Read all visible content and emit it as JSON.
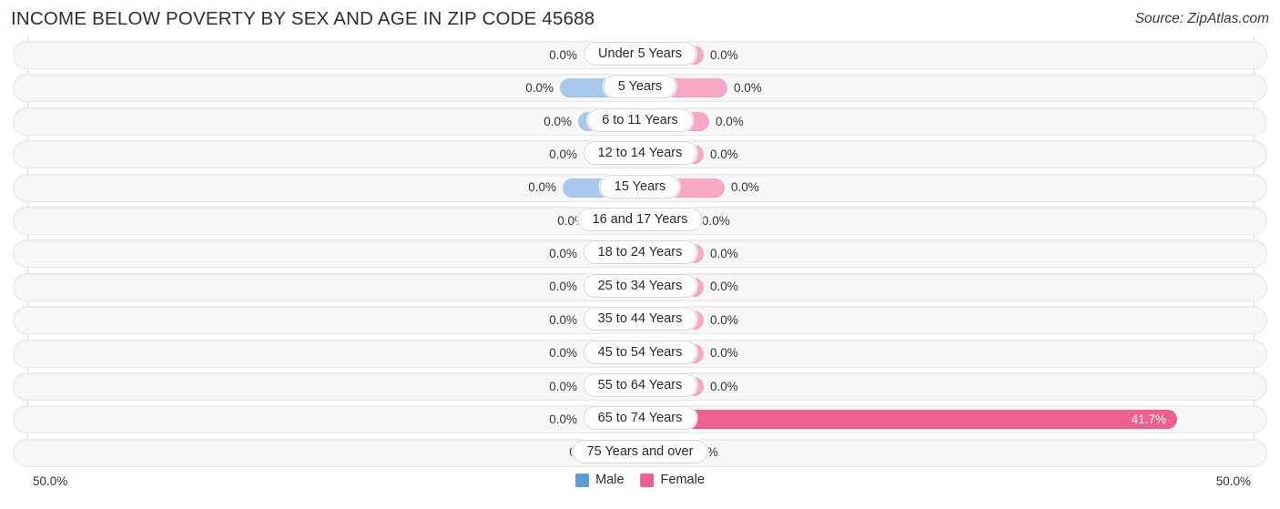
{
  "header": {
    "title": "INCOME BELOW POVERTY BY SEX AND AGE IN ZIP CODE 45688",
    "source": "Source: ZipAtlas.com"
  },
  "axis": {
    "left_tick": "50.0%",
    "right_tick": "50.0%"
  },
  "legend": [
    {
      "label": "Male",
      "color": "#5b9bd5"
    },
    {
      "label": "Female",
      "color": "#f0608e"
    }
  ],
  "colors": {
    "male_bar": "#a8c8ec",
    "female_bar": "#f7a8c4",
    "female_bar_highlight": "#f0608e",
    "track": "#f7f7f7"
  },
  "chart_data": {
    "type": "bar",
    "title": "INCOME BELOW POVERTY BY SEX AND AGE IN ZIP CODE 45688",
    "orientation": "horizontal-diverging",
    "xlabel": "",
    "ylabel": "",
    "xlim": [
      50.0,
      50.0
    ],
    "unit": "%",
    "grid": false,
    "legend_position": "bottom-center",
    "categories": [
      "Under 5 Years",
      "5 Years",
      "6 to 11 Years",
      "12 to 14 Years",
      "15 Years",
      "16 and 17 Years",
      "18 to 24 Years",
      "25 to 34 Years",
      "35 to 44 Years",
      "45 to 54 Years",
      "55 to 64 Years",
      "65 to 74 Years",
      "75 Years and over"
    ],
    "series": [
      {
        "name": "Male",
        "values": [
          0.0,
          0.0,
          0.0,
          0.0,
          0.0,
          0.0,
          0.0,
          0.0,
          0.0,
          0.0,
          0.0,
          0.0,
          0.0
        ]
      },
      {
        "name": "Female",
        "values": [
          0.0,
          0.0,
          0.0,
          0.0,
          0.0,
          0.0,
          0.0,
          0.0,
          0.0,
          0.0,
          0.0,
          41.7,
          0.0
        ]
      }
    ]
  },
  "rows": [
    {
      "label": "Under 5 Years",
      "male": "0.0%",
      "female": "0.0%",
      "male_w": 62,
      "female_w": 70,
      "female_hi": false,
      "female_inside": false
    },
    {
      "label": "5 Years",
      "male": "0.0%",
      "female": "0.0%",
      "male_w": 88,
      "female_w": 96,
      "female_hi": false,
      "female_inside": false
    },
    {
      "label": "6 to 11 Years",
      "male": "0.0%",
      "female": "0.0%",
      "male_w": 68,
      "female_w": 76,
      "female_hi": false,
      "female_inside": false
    },
    {
      "label": "12 to 14 Years",
      "male": "0.0%",
      "female": "0.0%",
      "male_w": 62,
      "female_w": 70,
      "female_hi": false,
      "female_inside": false
    },
    {
      "label": "15 Years",
      "male": "0.0%",
      "female": "0.0%",
      "male_w": 85,
      "female_w": 93,
      "female_hi": false,
      "female_inside": false
    },
    {
      "label": "16 and 17 Years",
      "male": "0.0%",
      "female": "0.0%",
      "male_w": 53,
      "female_w": 61,
      "female_hi": false,
      "female_inside": false
    },
    {
      "label": "18 to 24 Years",
      "male": "0.0%",
      "female": "0.0%",
      "male_w": 62,
      "female_w": 70,
      "female_hi": false,
      "female_inside": false
    },
    {
      "label": "25 to 34 Years",
      "male": "0.0%",
      "female": "0.0%",
      "male_w": 62,
      "female_w": 70,
      "female_hi": false,
      "female_inside": false
    },
    {
      "label": "35 to 44 Years",
      "male": "0.0%",
      "female": "0.0%",
      "male_w": 62,
      "female_w": 70,
      "female_hi": false,
      "female_inside": false
    },
    {
      "label": "45 to 54 Years",
      "male": "0.0%",
      "female": "0.0%",
      "male_w": 62,
      "female_w": 70,
      "female_hi": false,
      "female_inside": false
    },
    {
      "label": "55 to 64 Years",
      "male": "0.0%",
      "female": "0.0%",
      "male_w": 62,
      "female_w": 70,
      "female_hi": false,
      "female_inside": false
    },
    {
      "label": "65 to 74 Years",
      "male": "0.0%",
      "female": "41.7%",
      "male_w": 62,
      "female_w": 590,
      "female_hi": true,
      "female_inside": true
    },
    {
      "label": "75 Years and over",
      "male": "0.0%",
      "female": "0.0%",
      "male_w": 40,
      "female_w": 48,
      "female_hi": false,
      "female_inside": false
    }
  ]
}
